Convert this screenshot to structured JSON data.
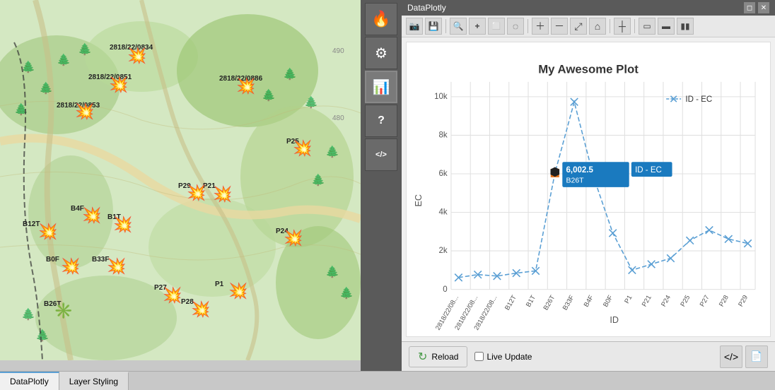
{
  "app": {
    "title": "DataPlotly",
    "titlebar_controls": [
      "restore",
      "close"
    ]
  },
  "sidebar": {
    "buttons": [
      {
        "name": "fire-icon",
        "symbol": "🔥",
        "active": false
      },
      {
        "name": "settings-icon",
        "symbol": "⚙",
        "active": false
      },
      {
        "name": "chart-icon",
        "symbol": "📊",
        "active": true
      },
      {
        "name": "help-icon",
        "symbol": "?",
        "active": false
      },
      {
        "name": "code-icon",
        "symbol": "</>",
        "active": false
      }
    ]
  },
  "chart_toolbar": {
    "icons": [
      {
        "name": "camera",
        "symbol": "📷"
      },
      {
        "name": "save",
        "symbol": "💾"
      },
      {
        "name": "zoom-in",
        "symbol": "🔍"
      },
      {
        "name": "plus",
        "symbol": "+"
      },
      {
        "name": "select",
        "symbol": "⬜"
      },
      {
        "name": "lasso",
        "symbol": "◌"
      },
      {
        "name": "zoom-add",
        "symbol": "＋"
      },
      {
        "name": "zoom-remove",
        "symbol": "－"
      },
      {
        "name": "fit",
        "symbol": "⤢"
      },
      {
        "name": "home",
        "symbol": "⌂"
      },
      {
        "name": "spike",
        "symbol": "┼"
      },
      {
        "name": "rect",
        "symbol": "▭"
      },
      {
        "name": "line",
        "symbol": "▬"
      },
      {
        "name": "bar-chart",
        "symbol": "▮▮"
      }
    ]
  },
  "chart": {
    "title": "My Awesome Plot",
    "x_label": "ID",
    "y_label": "EC",
    "legend_label": "ID - EC",
    "y_ticks": [
      "2k",
      "4k",
      "6k",
      "8k",
      "10k"
    ],
    "x_ticks": [
      "2818/22/08...",
      "2818/22/08...",
      "2818/22/08...",
      "B12T",
      "B26T",
      "B4F",
      "P1",
      "P24",
      "P25",
      "P27",
      "P28",
      "P29"
    ],
    "tooltip": {
      "value": "6,002.5",
      "label": "ID - EC",
      "sublabel": "B26T"
    },
    "data_points": [
      {
        "id": "2818/22/0834",
        "y": 1200,
        "x": 0
      },
      {
        "id": "2818/22/0851",
        "y": 1400,
        "x": 1
      },
      {
        "id": "2818/22/0853",
        "y": 1300,
        "x": 2
      },
      {
        "id": "2818/22/0886",
        "y": 1500,
        "x": 3
      },
      {
        "id": "B12T",
        "y": 1600,
        "x": 4
      },
      {
        "id": "B26T",
        "y": 6002.5,
        "x": 5
      },
      {
        "id": "B33F",
        "y": 9700,
        "x": 6
      },
      {
        "id": "B4F",
        "y": 5800,
        "x": 7
      },
      {
        "id": "B0F",
        "y": 2900,
        "x": 8
      },
      {
        "id": "P1",
        "y": 1600,
        "x": 9
      },
      {
        "id": "P21",
        "y": 1800,
        "x": 10
      },
      {
        "id": "P24",
        "y": 2200,
        "x": 11
      },
      {
        "id": "P25",
        "y": 2600,
        "x": 12
      },
      {
        "id": "P27",
        "y": 3100,
        "x": 13
      },
      {
        "id": "P28",
        "y": 2800,
        "x": 14
      },
      {
        "id": "P29",
        "y": 2500,
        "x": 15
      }
    ]
  },
  "bottom_bar": {
    "reload_label": "Reload",
    "live_update_label": "Live Update",
    "live_update_checked": false
  },
  "footer_tabs": [
    {
      "label": "DataPlotly",
      "active": true
    },
    {
      "label": "Layer Styling",
      "active": false
    }
  ],
  "map": {
    "markers": [
      {
        "id": "2818/22/0834",
        "x": 195,
        "y": 75,
        "type": "star"
      },
      {
        "id": "2818/22/0851",
        "x": 168,
        "y": 115,
        "type": "star"
      },
      {
        "id": "2818/22/0853",
        "x": 120,
        "y": 155,
        "type": "star"
      },
      {
        "id": "2818/22/0886",
        "x": 345,
        "y": 120,
        "type": "star"
      },
      {
        "id": "B12T",
        "x": 72,
        "y": 325,
        "type": "star"
      },
      {
        "id": "B1T",
        "x": 175,
        "y": 315,
        "type": "star"
      },
      {
        "id": "B4F",
        "x": 135,
        "y": 302,
        "type": "star"
      },
      {
        "id": "B33F",
        "x": 168,
        "y": 374,
        "type": "star"
      },
      {
        "id": "B0F",
        "x": 103,
        "y": 374,
        "type": "star"
      },
      {
        "id": "B26T",
        "x": 90,
        "y": 437,
        "type": "sun"
      },
      {
        "id": "P1",
        "x": 336,
        "y": 408,
        "type": "star"
      },
      {
        "id": "P21",
        "x": 314,
        "y": 272,
        "type": "star"
      },
      {
        "id": "P24",
        "x": 415,
        "y": 334,
        "type": "star"
      },
      {
        "id": "P25",
        "x": 432,
        "y": 207,
        "type": "star"
      },
      {
        "id": "P27",
        "x": 247,
        "y": 416,
        "type": "star"
      },
      {
        "id": "P28",
        "x": 285,
        "y": 435,
        "type": "star"
      },
      {
        "id": "P29",
        "x": 278,
        "y": 270,
        "type": "star"
      }
    ]
  }
}
